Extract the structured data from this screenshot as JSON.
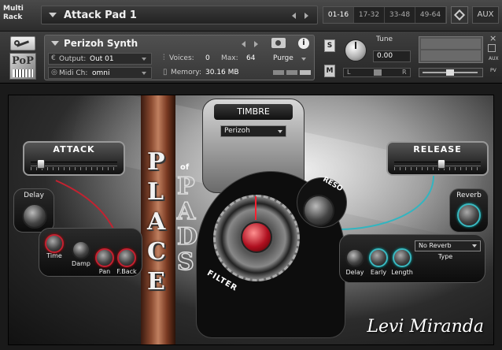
{
  "rack": {
    "label_line1": "Multi",
    "label_line2": "Rack",
    "name": "Attack Pad 1",
    "ranges": [
      "01-16",
      "17-32",
      "33-48",
      "49-64"
    ],
    "aux": "AUX"
  },
  "instrument": {
    "name": "Perizoh Synth",
    "output_label": "Output:",
    "output_value": "Out 01",
    "midi_label": "Midi Ch:",
    "midi_value": "omni",
    "voices_label": "Voices:",
    "voices_value": "0",
    "max_label": "Max:",
    "max_value": "64",
    "memory_label": "Memory:",
    "memory_value": "30.16 MB",
    "purge": "Purge",
    "solo": "S",
    "mute": "M",
    "tune_label": "Tune",
    "tune_value": "0.00",
    "pan_left": "L",
    "pan_right": "R",
    "logo": "PoP",
    "side_aux": "AUX",
    "side_pv": "PV"
  },
  "panel": {
    "title_letters": [
      "P",
      "L",
      "A",
      "C",
      "E"
    ],
    "of": "of",
    "pads_letters": [
      "P",
      "A",
      "D",
      "S"
    ],
    "timbre_title": "TIMBRE",
    "timbre_value": "Perizoh",
    "attack_title": "ATTACK",
    "release_title": "RELEASE",
    "attack_level": 0.1,
    "release_level": 0.55,
    "reso": "RESO",
    "filter": "FILTER",
    "delay_title": "Delay",
    "delay_knobs": [
      "Time",
      "Damp",
      "Pan",
      "F.Back"
    ],
    "reverb_title": "Reverb",
    "reverb_value": "No Reverb",
    "reverb_type_label": "Type",
    "reverb_knobs": [
      "Delay",
      "Early",
      "Length"
    ],
    "signature": "Levi Miranda"
  }
}
